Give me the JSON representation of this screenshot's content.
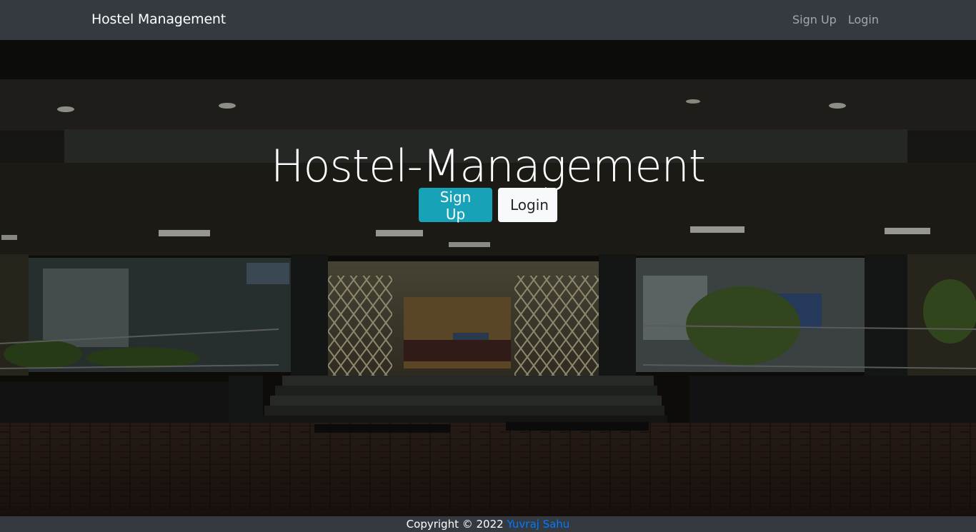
{
  "navbar": {
    "brand": "Hostel Management",
    "links": [
      "Sign Up",
      "Login"
    ]
  },
  "hero": {
    "title": "Hostel-Management",
    "buttons": {
      "signup": "Sign Up",
      "login": "Login"
    }
  },
  "footer": {
    "copyright": "Copyright © 2022",
    "author": "Yuvraj Sahu"
  },
  "colors": {
    "navbar_bg": "#343a40",
    "signup_button": "#17a2b8",
    "login_button": "#f8f9fa",
    "author_link": "#007bff"
  }
}
